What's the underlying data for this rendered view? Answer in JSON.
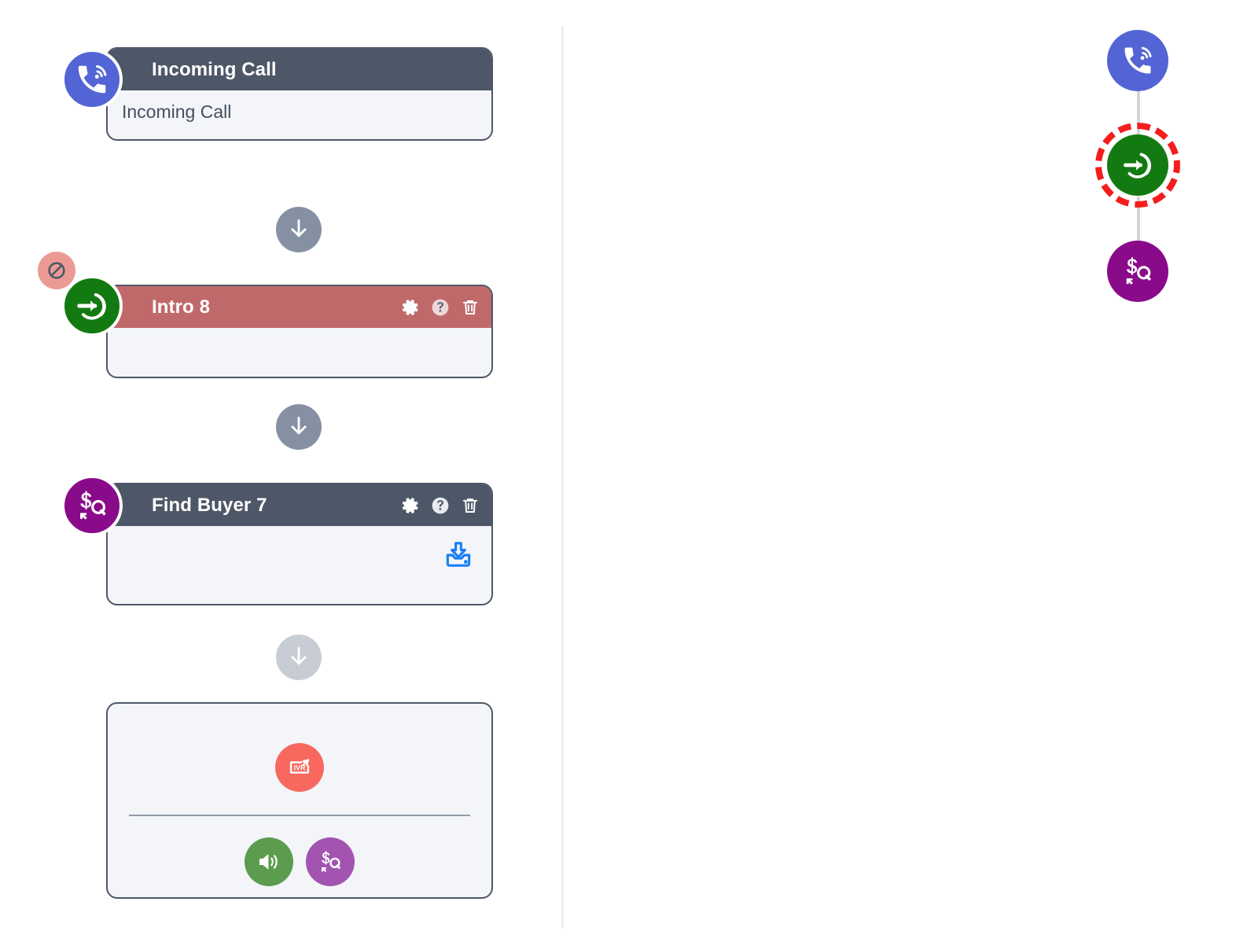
{
  "flow": {
    "nodes": [
      {
        "id": "incoming-call",
        "title": "Incoming Call",
        "body_text": "Incoming Call",
        "header_style": "dark",
        "badge_icon": "incoming-call-icon",
        "badge_color": "#5365d4",
        "has_actions": false,
        "blocked": false
      },
      {
        "id": "intro-8",
        "title": "Intro 8",
        "body_text": "",
        "header_style": "red",
        "badge_icon": "enter-arrow-icon",
        "badge_color": "#137a12",
        "has_actions": true,
        "blocked": true,
        "blocked_icon": "blocked-icon"
      },
      {
        "id": "find-buyer-7",
        "title": "Find Buyer 7",
        "body_text": "",
        "header_style": "dark",
        "badge_icon": "find-buyer-icon",
        "badge_color": "#8a0b8a",
        "has_actions": true,
        "blocked": false,
        "body_icon": "download-inbox-icon",
        "body_icon_color": "#1a7ef5"
      }
    ],
    "header_actions": [
      {
        "name": "settings-button",
        "icon": "gear-icon"
      },
      {
        "name": "help-button",
        "icon": "question-mark-icon"
      },
      {
        "name": "delete-button",
        "icon": "trash-icon"
      }
    ],
    "connectors": [
      {
        "state": "active",
        "icon": "arrow-down-icon"
      },
      {
        "state": "active",
        "icon": "arrow-down-icon"
      },
      {
        "state": "inactive",
        "icon": "arrow-down-icon"
      }
    ]
  },
  "palette": {
    "primary": {
      "name": "ivr-node-button",
      "icon": "ivr-icon",
      "color": "#f9685f"
    },
    "options": [
      {
        "name": "play-audio-node-button",
        "icon": "speaker-icon",
        "color": "#5c9c4e"
      },
      {
        "name": "find-buyer-node-button",
        "icon": "find-buyer-icon",
        "color": "#a254b0"
      }
    ]
  },
  "minimap": {
    "nodes": [
      {
        "id": "incoming-call",
        "icon": "incoming-call-icon",
        "color": "#5365d4",
        "highlighted": false
      },
      {
        "id": "intro-8",
        "icon": "enter-arrow-icon",
        "color": "#137a12",
        "highlighted": true
      },
      {
        "id": "find-buyer-7",
        "icon": "find-buyer-icon",
        "color": "#8a0b8a",
        "highlighted": false
      }
    ],
    "highlight_color": "#f41d1d",
    "connector_color": "#d2d4d8"
  },
  "colors": {
    "header_dark": "#4e5767",
    "header_red": "#c0696b",
    "card_body": "#f3f5f9",
    "connector_active": "#8591a2",
    "connector_inactive": "#c8ccd4",
    "divider": "#eceef2"
  }
}
